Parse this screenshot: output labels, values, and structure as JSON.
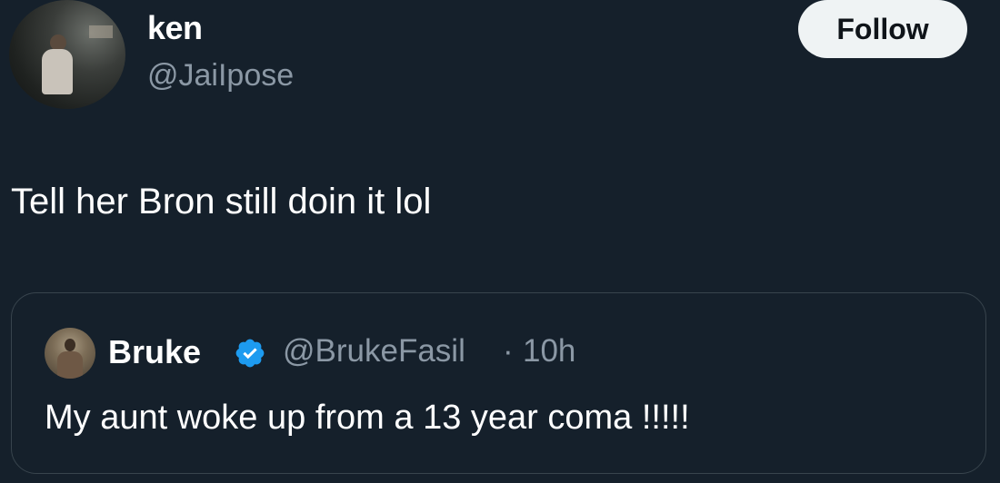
{
  "author": {
    "display_name": "ken",
    "handle": "@JaiIpose"
  },
  "follow_button": {
    "label": "Follow"
  },
  "tweet": {
    "text": "Tell her Bron still doin it lol"
  },
  "quoted_tweet": {
    "display_name": "Bruke",
    "verified_icon": "verified-badge-icon",
    "handle": "@BrukeFasil",
    "separator": "·",
    "time": "10h",
    "text": "My aunt woke up from a 13 year coma !!!!!"
  },
  "colors": {
    "background": "#15202b",
    "secondary_text": "#8b98a5",
    "verified_blue": "#1d9bf0",
    "button_bg": "#eff3f4",
    "card_border": "#38444d"
  }
}
